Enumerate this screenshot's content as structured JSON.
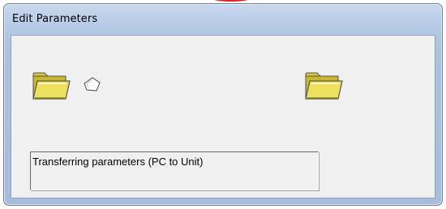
{
  "window": {
    "title": "Edit Parameters"
  },
  "transfer": {
    "source_icon": "folder-icon",
    "target_icon": "folder-icon",
    "moving_item_icon": "document-icon",
    "status_text": "Transferring parameters (PC to Unit)"
  },
  "colors": {
    "folder_fill": "#e8dc5a",
    "folder_shade": "#b8a81c",
    "title_bar": "#b6cbe6",
    "client_bg": "#f0f0f0",
    "accent": "#e02020"
  }
}
